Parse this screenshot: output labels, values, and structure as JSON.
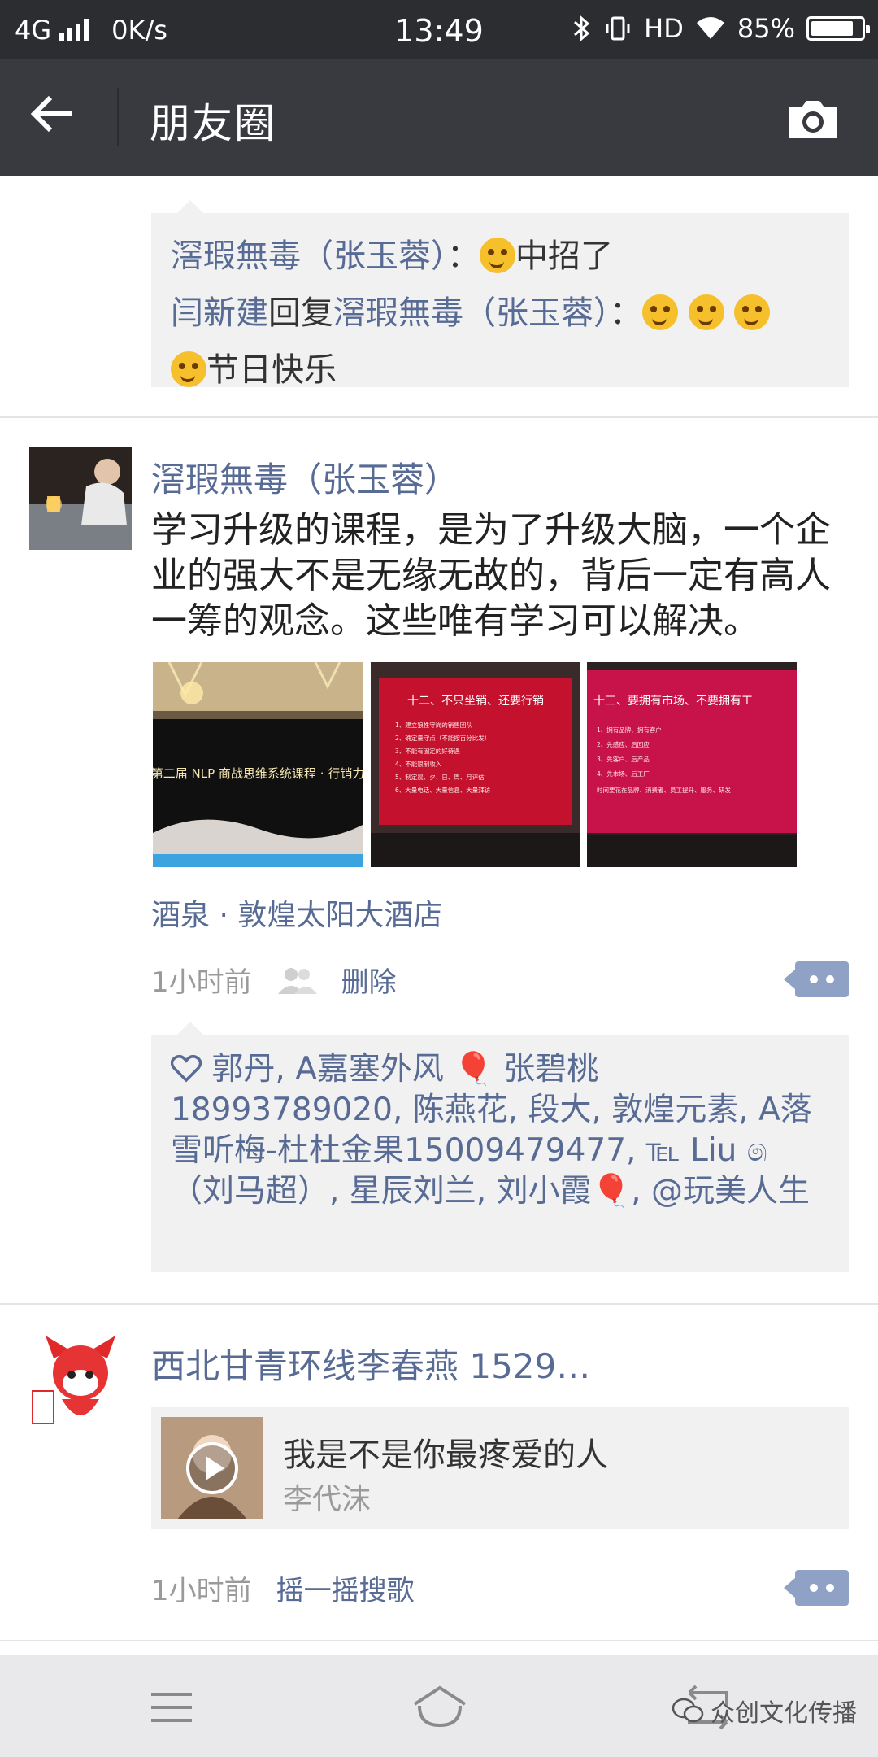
{
  "status_bar": {
    "network": "4G",
    "speed": "0K/s",
    "time": "13:49",
    "hd": "HD",
    "battery_text": "85%",
    "battery_level": 0.85
  },
  "nav": {
    "title": "朋友圈"
  },
  "top_comments": {
    "c1_user": "滘瑕無毒（张玉蓉）",
    "c1_colon": "：",
    "c1_text": "中招了",
    "c2_user": "闫新建",
    "c2_reply": "回复",
    "c2_target": "滘瑕無毒（张玉蓉）",
    "c2_colon": "：",
    "c2_text": "节日快乐"
  },
  "post1": {
    "author": "滘瑕無毒（张玉蓉）",
    "text": "学习升级的课程，是为了升级大脑，一个企业的强大不是无缘无故的，背后一定有高人一筹的观念。这些唯有学习可以解决。",
    "photo1_banner": "第二届 NLP 商战思维系统课程 · 行销力",
    "photo2_heading": "十二、不只坐销、还要行销",
    "photo2_lines": [
      "1、建立狼性守岗的销售团队",
      "2、确定量守点（不能按百分比发）",
      "3、不能有固定的好待遇",
      "4、不能限制收入",
      "5、制定晨、夕、日、周、月评估",
      "6、大量电话、大量信息、大量拜访"
    ],
    "photo3_heading": "十三、要拥有市场、不要拥有工",
    "photo3_lines": [
      "1、拥有品牌、拥有客户",
      "2、先感应、后回应",
      "3、先客户、后产品",
      "4、先市场、后工厂",
      "时间要花在品牌、消费者、员工提升、服务、研发"
    ],
    "location": "酒泉 · 敦煌太阳大酒店",
    "time": "1小时前",
    "delete_label": "删除",
    "likes": "郭丹, A嘉塞外风 🎈 张碧桃18993789020, 陈燕花, 段大, 敦煌元素, A落雪听梅-杜杜金果15009479477, ℡ Liu ෧（刘马超）, 星辰刘兰, 刘小霞🎈, @玩美人生"
  },
  "post2": {
    "author": "西北甘青环线李春燕 1529…",
    "music_title": "我是不是你最疼爱的人",
    "music_artist": "李代沫",
    "time": "1小时前",
    "source_label": "摇一摇搜歌"
  },
  "watermark": "众创文化传播",
  "colors": {
    "nav_bg": "#393a3f",
    "status_bg": "#2b2d31",
    "link": "#586b95",
    "comment_bg": "#f1f1f1",
    "action_btn": "#8fa2c5"
  }
}
